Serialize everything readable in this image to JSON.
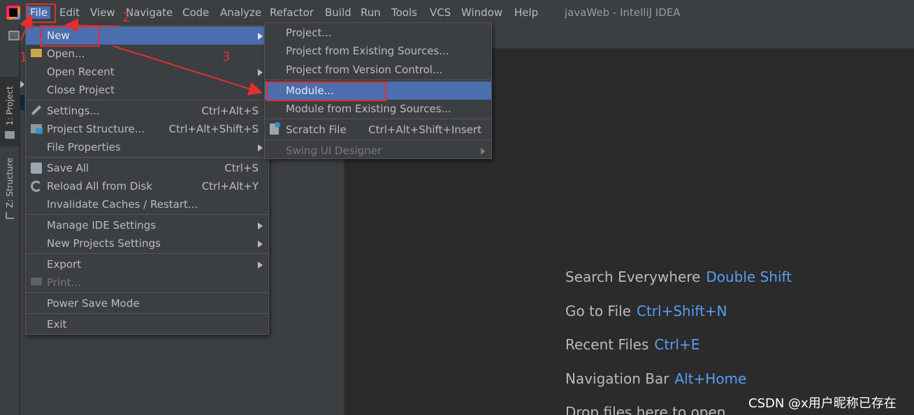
{
  "app": {
    "window_title": "javaWeb - IntelliJ IDEA"
  },
  "menubar": {
    "items": [
      "File",
      "Edit",
      "View",
      "Navigate",
      "Code",
      "Analyze",
      "Refactor",
      "Build",
      "Run",
      "Tools",
      "VCS",
      "Window",
      "Help"
    ]
  },
  "tool_windows": {
    "project": "1: Project",
    "structure": "Z: Structure"
  },
  "file_menu": {
    "new": "New",
    "open": "Open...",
    "open_recent": "Open Recent",
    "close_project": "Close Project",
    "settings": "Settings...",
    "settings_shortcut": "Ctrl+Alt+S",
    "project_structure": "Project Structure...",
    "project_structure_shortcut": "Ctrl+Alt+Shift+S",
    "file_properties": "File Properties",
    "save_all": "Save All",
    "save_all_shortcut": "Ctrl+S",
    "reload": "Reload All from Disk",
    "reload_shortcut": "Ctrl+Alt+Y",
    "invalidate": "Invalidate Caches / Restart...",
    "manage_ide": "Manage IDE Settings",
    "new_projects_settings": "New Projects Settings",
    "export": "Export",
    "print": "Print...",
    "power_save": "Power Save Mode",
    "exit": "Exit"
  },
  "new_submenu": {
    "project": "Project...",
    "project_existing": "Project from Existing Sources...",
    "project_vcs": "Project from Version Control...",
    "module": "Module...",
    "module_existing": "Module from Existing Sources...",
    "scratch_file": "Scratch File",
    "scratch_shortcut": "Ctrl+Alt+Shift+Insert",
    "swing_ui": "Swing UI Designer"
  },
  "editor_hints": {
    "search_label": "Search Everywhere",
    "search_key": "Double Shift",
    "goto_label": "Go to File",
    "goto_key": "Ctrl+Shift+N",
    "recent_label": "Recent Files",
    "recent_key": "Ctrl+E",
    "nav_label": "Navigation Bar",
    "nav_key": "Alt+Home",
    "drop_label": "Drop files here to open"
  },
  "annotations": {
    "n1": "1",
    "n2": "2",
    "n3": "3"
  },
  "watermark": "CSDN @x用户昵称已存在",
  "colors": {
    "selection": "#4b6eaf",
    "annotation": "#e03030",
    "shortcut_key": "#589df6"
  }
}
